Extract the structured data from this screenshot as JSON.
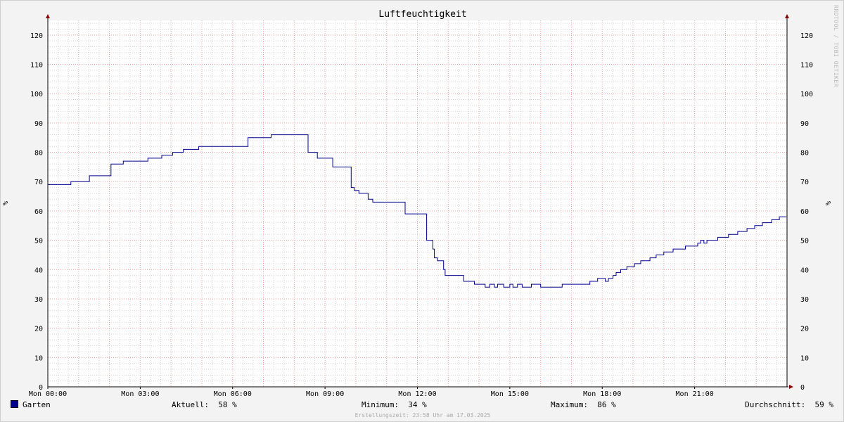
{
  "watermark": "RRDTOOL / TOBI OETIKER",
  "chart_data": {
    "type": "line",
    "title": "Luftfeuchtigkeit",
    "ylabel": "%",
    "ylim": [
      0,
      125
    ],
    "yticks": [
      0,
      10,
      20,
      30,
      40,
      50,
      60,
      70,
      80,
      90,
      100,
      110,
      120
    ],
    "xlim_hours": [
      0,
      24
    ],
    "xticks": [
      {
        "h": 0,
        "label": "Mon 00:00"
      },
      {
        "h": 3,
        "label": "Mon 03:00"
      },
      {
        "h": 6,
        "label": "Mon 06:00"
      },
      {
        "h": 9,
        "label": "Mon 09:00"
      },
      {
        "h": 12,
        "label": "Mon 12:00"
      },
      {
        "h": 15,
        "label": "Mon 15:00"
      },
      {
        "h": 18,
        "label": "Mon 18:00"
      },
      {
        "h": 21,
        "label": "Mon 21:00"
      }
    ],
    "grid": true,
    "legend_position": "bottom-left",
    "series": [
      {
        "name": "Garten",
        "color": "#00008b",
        "points": [
          [
            0.0,
            69
          ],
          [
            0.75,
            70
          ],
          [
            1.35,
            72
          ],
          [
            2.05,
            76
          ],
          [
            2.45,
            77
          ],
          [
            3.25,
            78
          ],
          [
            3.7,
            79
          ],
          [
            4.05,
            80
          ],
          [
            4.4,
            81
          ],
          [
            4.9,
            82
          ],
          [
            6.5,
            85
          ],
          [
            7.25,
            86
          ],
          [
            8.45,
            80
          ],
          [
            8.75,
            78
          ],
          [
            9.25,
            75
          ],
          [
            9.85,
            68
          ],
          [
            9.95,
            67
          ],
          [
            10.1,
            66
          ],
          [
            10.4,
            64
          ],
          [
            10.55,
            63
          ],
          [
            11.6,
            59
          ],
          [
            12.3,
            50
          ],
          [
            12.5,
            47
          ],
          [
            12.55,
            44
          ],
          [
            12.65,
            43
          ],
          [
            12.85,
            40
          ],
          [
            12.9,
            38
          ],
          [
            13.5,
            36
          ],
          [
            13.85,
            35
          ],
          [
            14.2,
            34
          ],
          [
            14.35,
            35
          ],
          [
            14.5,
            34
          ],
          [
            14.6,
            35
          ],
          [
            14.8,
            34
          ],
          [
            15.0,
            35
          ],
          [
            15.1,
            34
          ],
          [
            15.25,
            35
          ],
          [
            15.4,
            34
          ],
          [
            15.7,
            35
          ],
          [
            16.0,
            34
          ],
          [
            16.7,
            35
          ],
          [
            17.6,
            36
          ],
          [
            17.85,
            37
          ],
          [
            18.1,
            36
          ],
          [
            18.2,
            37
          ],
          [
            18.35,
            38
          ],
          [
            18.45,
            39
          ],
          [
            18.6,
            40
          ],
          [
            18.8,
            41
          ],
          [
            19.05,
            42
          ],
          [
            19.25,
            43
          ],
          [
            19.55,
            44
          ],
          [
            19.75,
            45
          ],
          [
            20.0,
            46
          ],
          [
            20.3,
            47
          ],
          [
            20.7,
            48
          ],
          [
            21.1,
            49
          ],
          [
            21.2,
            50
          ],
          [
            21.3,
            49
          ],
          [
            21.4,
            50
          ],
          [
            21.75,
            51
          ],
          [
            22.1,
            52
          ],
          [
            22.4,
            53
          ],
          [
            22.7,
            54
          ],
          [
            22.95,
            55
          ],
          [
            23.2,
            56
          ],
          [
            23.5,
            57
          ],
          [
            23.75,
            58
          ],
          [
            23.98,
            58
          ]
        ]
      }
    ]
  },
  "legend": {
    "series_name": "Garten",
    "current_label": "Aktuell:",
    "current_value": "58 %",
    "min_label": "Minimum:",
    "min_value": "34 %",
    "max_label": "Maximum:",
    "max_value": "86 %",
    "avg_label": "Durchschnitt:",
    "avg_value": "59 %"
  },
  "footer_text": "Erstellungszeit: 23:58 Uhr am 17.03.2025",
  "colors": {
    "line": "#00008b",
    "major_grid": "#f0a0a0",
    "minor_grid": "#d6d6d6",
    "axis": "#000000",
    "arrow": "#8b0000",
    "plot_bg": "#ffffff"
  }
}
